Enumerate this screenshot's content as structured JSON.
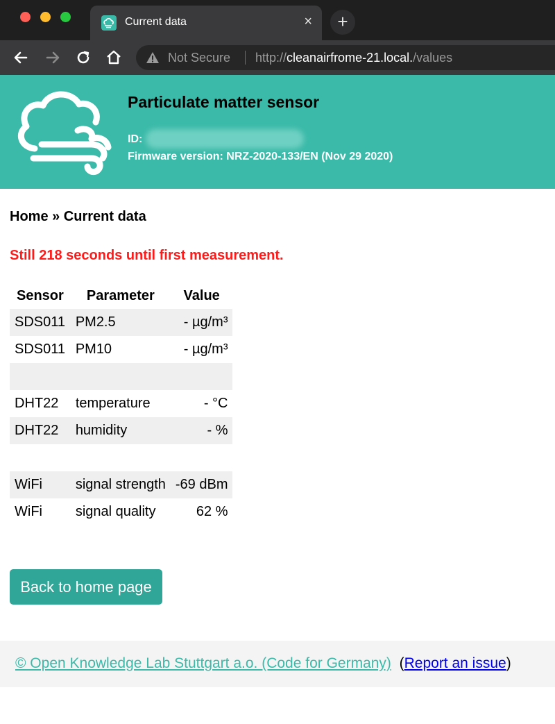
{
  "browser": {
    "tab_title": "Current data",
    "tab_close": "×",
    "new_tab": "+",
    "security_label": "Not Secure",
    "url_scheme": "http://",
    "url_host": "cleanairfrome-21.local.",
    "url_path": "/values"
  },
  "header": {
    "title": "Particulate matter sensor",
    "id_label": "ID:",
    "firmware": "Firmware version: NRZ-2020-133/EN (Nov 29 2020)"
  },
  "breadcrumb": "Home » Current data",
  "notice": "Still 218 seconds until first measurement.",
  "table": {
    "headers": [
      "Sensor",
      "Parameter",
      "Value"
    ],
    "rows": [
      [
        "SDS011",
        "PM2.5",
        "- µg/m³"
      ],
      [
        "SDS011",
        "PM10",
        "- µg/m³"
      ],
      [
        "",
        "",
        ""
      ],
      [
        "DHT22",
        "temperature",
        "- °C"
      ],
      [
        "DHT22",
        "humidity",
        "- %"
      ],
      [
        "",
        "",
        ""
      ],
      [
        "WiFi",
        "signal strength",
        "-69 dBm"
      ],
      [
        "WiFi",
        "signal quality",
        "62 %"
      ]
    ]
  },
  "back_button": "Back to home page",
  "footer": {
    "credit": "© Open Knowledge Lab Stuttgart a.o. (Code for Germany)",
    "open_paren": "(",
    "report": "Report an issue",
    "close_paren": ")"
  },
  "colors": {
    "header_bg": "#3bbaa9",
    "button_bg": "#2fa697",
    "notice_red": "#ff1a1a",
    "link_blue": "#0000ee"
  }
}
